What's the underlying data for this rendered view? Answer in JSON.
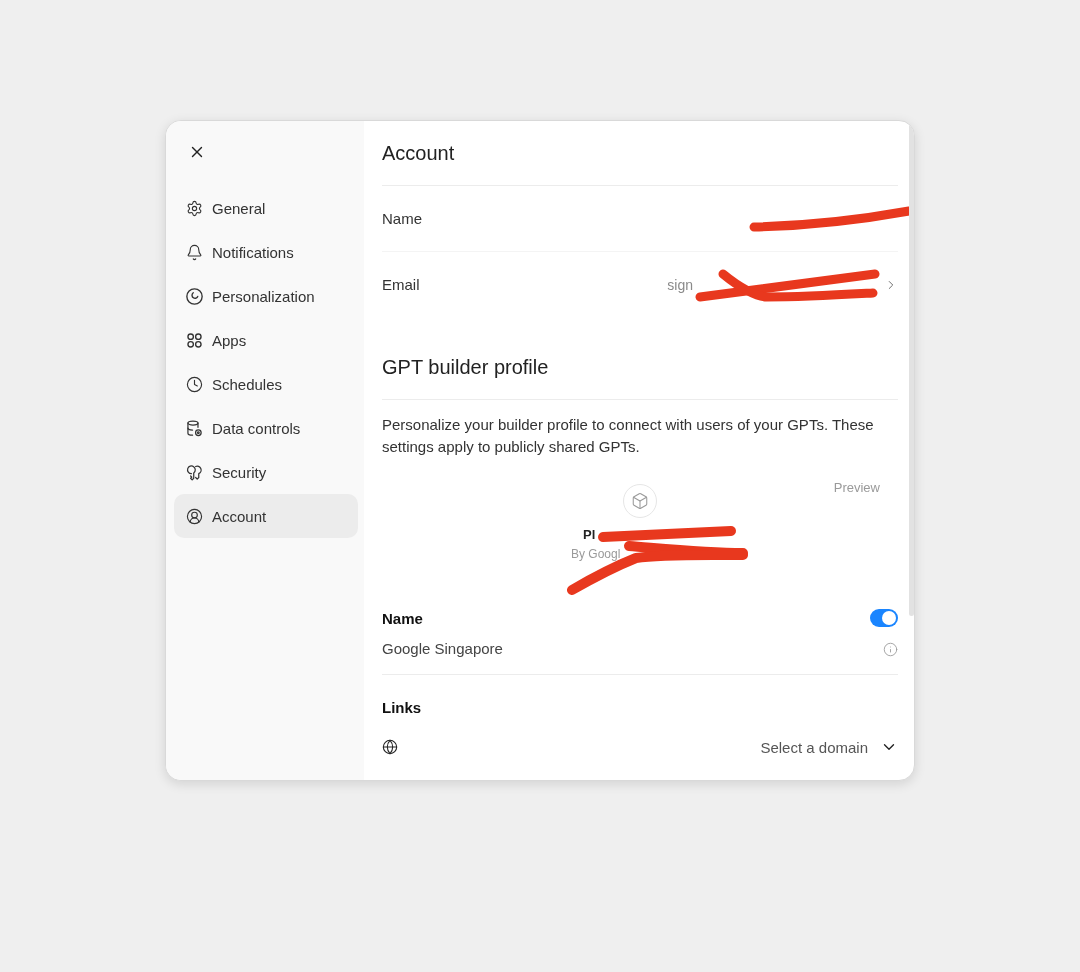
{
  "sidebar": {
    "items": [
      {
        "label": "General",
        "selected": false
      },
      {
        "label": "Notifications",
        "selected": false
      },
      {
        "label": "Personalization",
        "selected": false
      },
      {
        "label": "Apps",
        "selected": false
      },
      {
        "label": "Schedules",
        "selected": false
      },
      {
        "label": "Data controls",
        "selected": false
      },
      {
        "label": "Security",
        "selected": false
      },
      {
        "label": "Account",
        "selected": true
      }
    ]
  },
  "account": {
    "title": "Account",
    "rows": [
      {
        "kind": "plain",
        "label": "Name",
        "redacted": true
      },
      {
        "kind": "link",
        "label": "Email",
        "value": "sign",
        "redacted": true
      }
    ]
  },
  "builder_profile": {
    "title": "GPT builder profile",
    "description": "Personalize your builder profile to connect with users of your GPTs. These settings apply to publicly shared GPTs.",
    "preview": {
      "label": "Preview",
      "name": "Pl",
      "author": "By Googl",
      "redacted": true
    },
    "name": {
      "label": "Name",
      "value": "Google Singapore",
      "on": true
    },
    "links": {
      "label": "Links",
      "domain": {
        "placeholder": "Select a domain"
      }
    }
  }
}
